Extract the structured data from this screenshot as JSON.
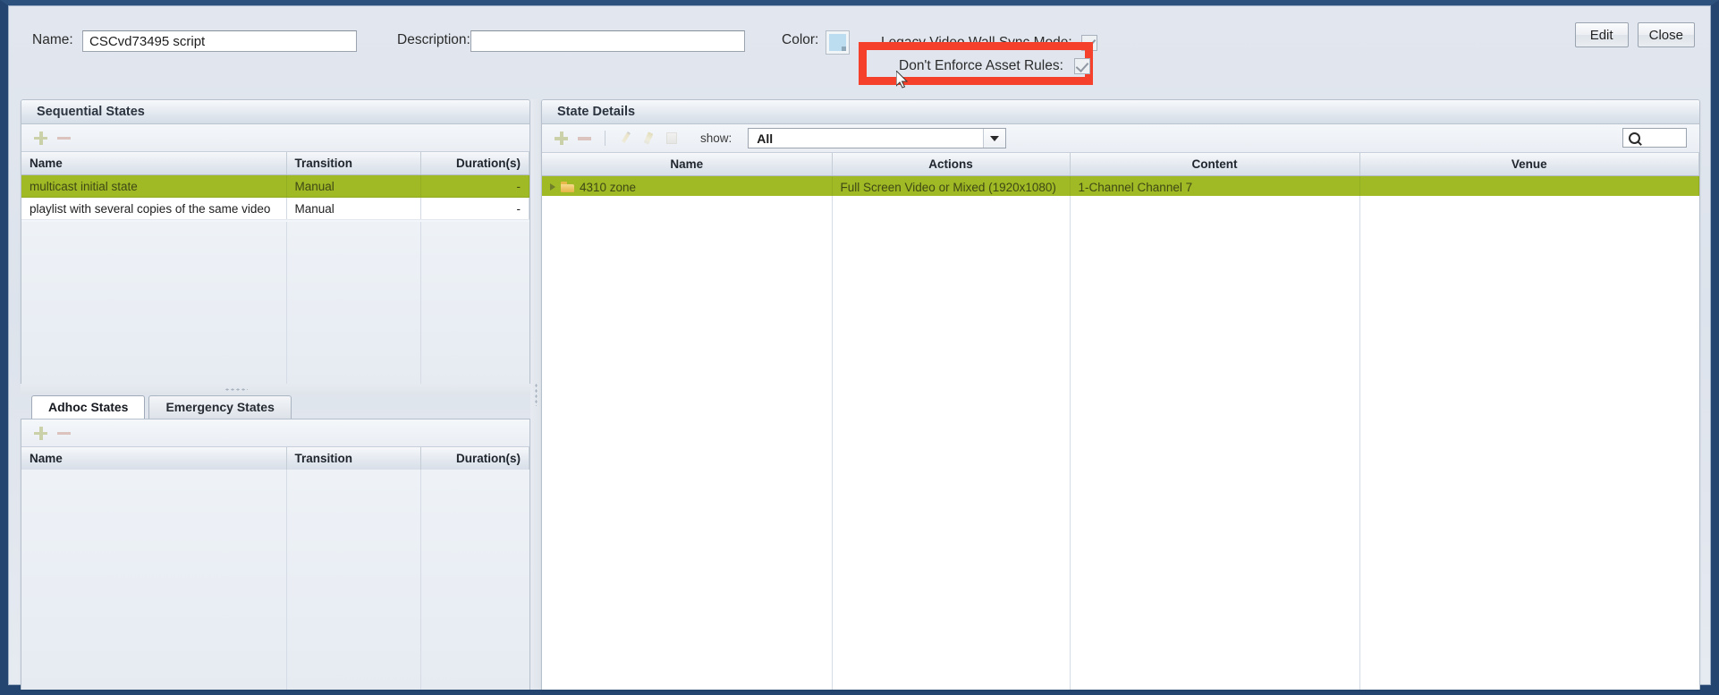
{
  "window": {
    "header": {
      "name_label": "Name:",
      "name_value": "CSCvd73495 script",
      "name_placeholder": "",
      "description_label": "Description:",
      "description_value": "",
      "description_placeholder": "",
      "color_label": "Color:",
      "color_swatch_hex": "#bcdcf0",
      "legacy_sync_label": "Legacy Video Wall Sync Mode:",
      "legacy_sync_checked": true,
      "enforce_rules_label": "Don't Enforce Asset Rules:",
      "enforce_rules_checked": true,
      "edit_button": "Edit",
      "close_button": "Close"
    },
    "annotation": {
      "type": "highlight-rectangle",
      "color_hex": "#f5402c",
      "targets_label": "Don't Enforce Asset Rules:"
    }
  },
  "sequential_states": {
    "title": "Sequential States",
    "toolbar": [
      {
        "icon": "plus-icon",
        "label": "Add"
      },
      {
        "icon": "minus-icon",
        "label": "Remove"
      }
    ],
    "columns": [
      "Name",
      "Transition",
      "Duration(s)"
    ],
    "rows": [
      {
        "name": "multicast initial state",
        "transition": "Manual",
        "duration": "-",
        "selected": true
      },
      {
        "name": "playlist with several copies of the same video",
        "transition": "Manual",
        "duration": "-",
        "selected": false
      }
    ]
  },
  "bottom_left_tabs": {
    "tabs": [
      {
        "label": "Adhoc States",
        "active": true
      },
      {
        "label": "Emergency States",
        "active": false
      }
    ],
    "toolbar": [
      {
        "icon": "plus-icon",
        "label": "Add"
      },
      {
        "icon": "minus-icon",
        "label": "Remove"
      }
    ],
    "columns": [
      "Name",
      "Transition",
      "Duration(s)"
    ],
    "rows": []
  },
  "state_details": {
    "title": "State Details",
    "toolbar": [
      {
        "icon": "plus-icon",
        "label": "Add"
      },
      {
        "icon": "minus-icon",
        "label": "Remove"
      },
      {
        "icon": "pencil-icon",
        "label": "Edit"
      },
      {
        "icon": "pencil-alt-icon",
        "label": "Edit Properties"
      },
      {
        "icon": "page-icon",
        "label": "Copy"
      }
    ],
    "show_label": "show:",
    "show_value": "All",
    "show_options": [
      "All"
    ],
    "search_placeholder": "",
    "search_value": "",
    "columns": [
      "Name",
      "Actions",
      "Content",
      "Venue"
    ],
    "rows": [
      {
        "name": "4310 zone",
        "actions": "Full Screen Video or Mixed (1920x1080)",
        "content": "1-Channel Channel 7",
        "venue": "",
        "selected": true,
        "expandable": true,
        "icon": "folder-icon"
      }
    ]
  }
}
